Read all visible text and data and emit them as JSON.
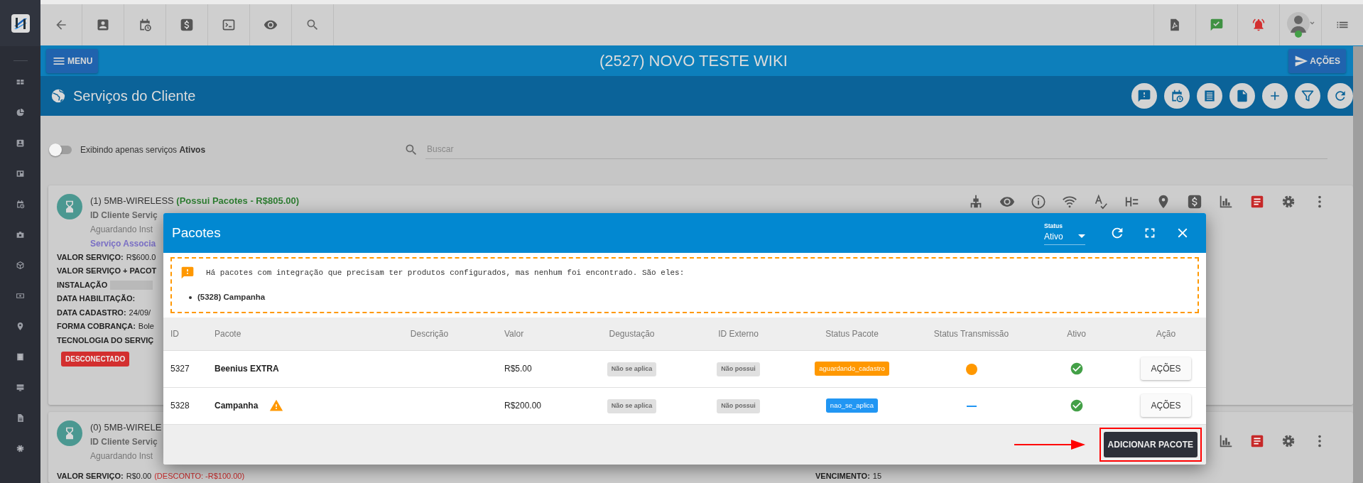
{
  "header": {
    "menu_button": "MENU",
    "title": "(2527) NOVO TESTE WIKI",
    "actions_button": "AÇÕES"
  },
  "page": {
    "title": "Serviços do Cliente"
  },
  "filter": {
    "toggle": {
      "on": false
    },
    "label": "Exibindo apenas serviços **Ativos**",
    "search": {
      "placeholder": "Buscar"
    }
  },
  "services": [
    {
      "title": "(1) 5MB-WIRELESS",
      "packages_note": "(Possui Pacotes - R$805.00)",
      "subtitle": "ID Cliente Serviç",
      "status_text": "Aguardando Inst",
      "link": "Serviço Associa",
      "fields": [
        {
          "label": "VALOR SERVIÇO:",
          "value": "R$600.0"
        },
        {
          "label": "VALOR SERVIÇO + PACOT"
        },
        {
          "label": "INSTALAÇÃO",
          "redacted": true
        },
        {
          "label": "DATA HABILITAÇÃO:"
        },
        {
          "label": "DATA CADASTRO:",
          "value": "24/09/"
        },
        {
          "label": "FORMA COBRANÇA:",
          "value": "Bole"
        },
        {
          "label": "TECNOLOGIA DO SERVIÇ"
        }
      ],
      "status_badge": "DESCONECTADO"
    },
    {
      "title": "(0) 5MB-WIRELE",
      "subtitle": "ID Cliente Serviç",
      "status_text": "Aguardando Inst",
      "fields": [
        {
          "label": "VALOR SERVIÇO:",
          "value": "R$0.00",
          "discount": "(DESCONTO: -R$100.00)"
        }
      ],
      "due": {
        "label": "VENCIMENTO:",
        "value": "15"
      }
    }
  ],
  "modal": {
    "title": "Pacotes",
    "status_filter": {
      "label": "Status",
      "value": "Ativo"
    },
    "alert": {
      "message": "Há pacotes com integração que precisam ter produtos configurados, mas nenhum foi encontrado. São eles:",
      "items": [
        "(5328) Campanha"
      ]
    },
    "table": {
      "columns": [
        "ID",
        "Pacote",
        "Descrição",
        "Valor",
        "Degustação",
        "ID Externo",
        "Status Pacote",
        "Status Transmissão",
        "Ativo",
        "Ação"
      ],
      "rows": [
        {
          "id": "5327",
          "pacote": "Beenius EXTRA",
          "warning": false,
          "valor": "R$5.00",
          "degustacao": "Não se aplica",
          "id_externo": "Não possui",
          "status_pacote": {
            "label": "aguardando_cadastro",
            "color": "#ff9800"
          },
          "status_transmissao": {
            "kind": "dot",
            "color": "#ff9800"
          },
          "ativo": true,
          "action": "AÇÕES"
        },
        {
          "id": "5328",
          "pacote": "Campanha",
          "warning": true,
          "valor": "R$200.00",
          "degustacao": "Não se aplica",
          "id_externo": "Não possui",
          "status_pacote": {
            "label": "nao_se_aplica",
            "color": "#2196f3"
          },
          "status_transmissao": {
            "kind": "dash",
            "color": "#2196f3"
          },
          "ativo": true,
          "action": "AÇÕES"
        }
      ]
    },
    "add_button": "ADICIONAR PACOTE"
  },
  "annotations": {
    "highlight_add_button": true,
    "arrow": true
  }
}
